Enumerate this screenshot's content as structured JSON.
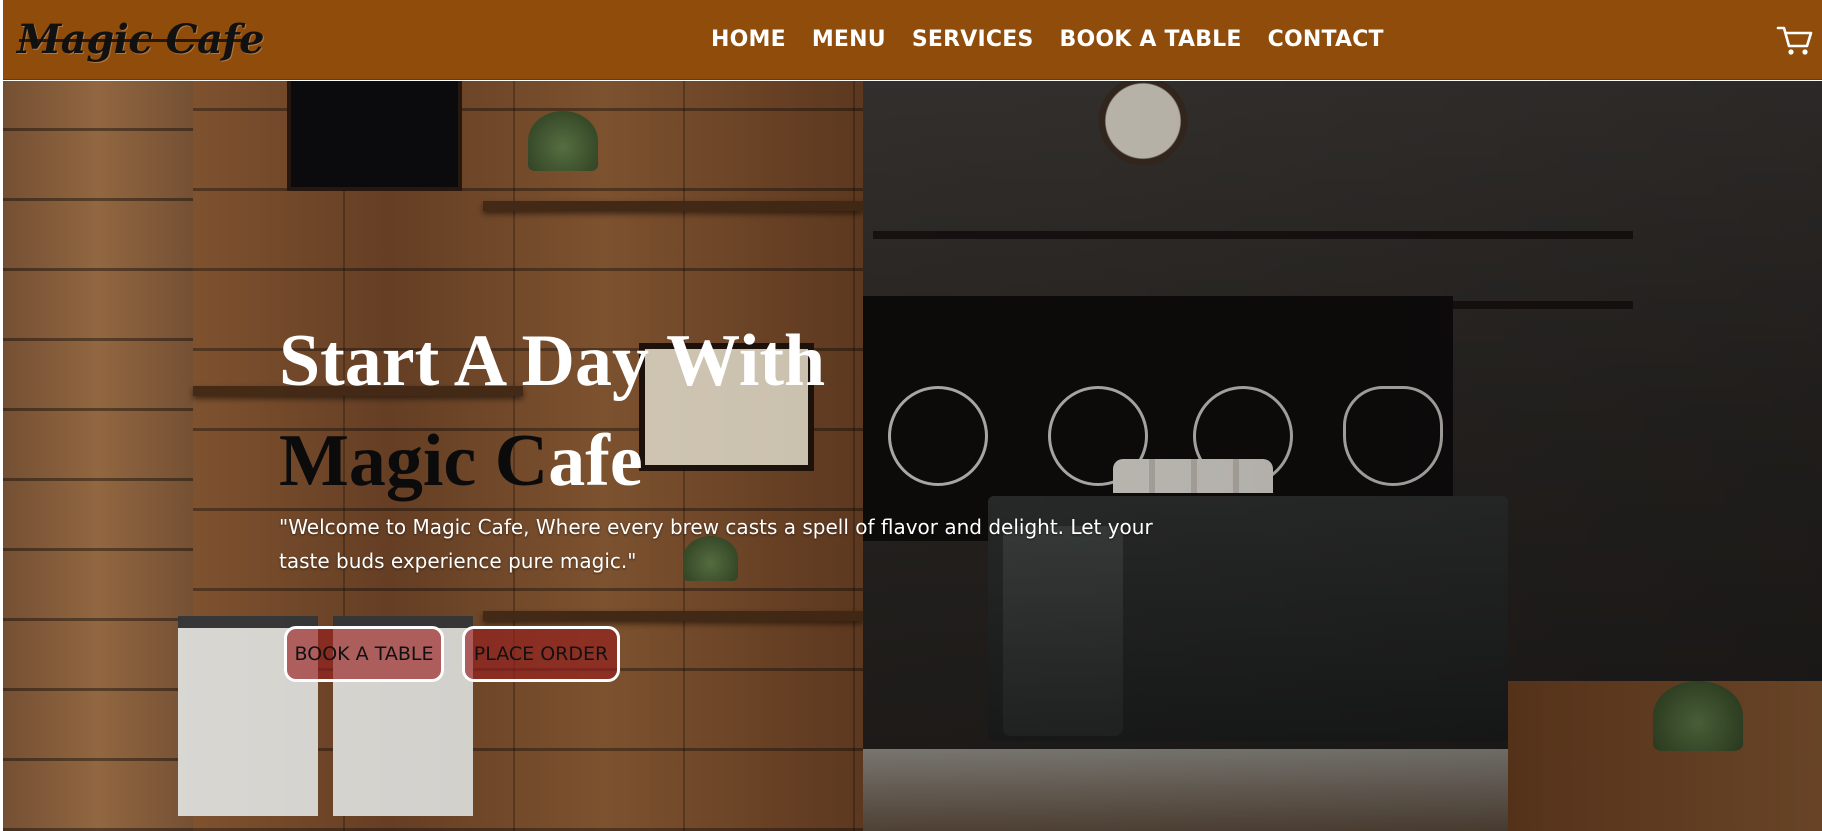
{
  "brand": {
    "name": "Magic Cafe"
  },
  "nav": {
    "items": [
      {
        "label": "HOME"
      },
      {
        "label": "MENU"
      },
      {
        "label": "SERVICES"
      },
      {
        "label": "BOOK A TABLE"
      },
      {
        "label": "CONTACT"
      }
    ],
    "cart_icon": "shopping-cart-icon"
  },
  "hero": {
    "title_line1": "Start A Day With",
    "title_line2_part1": "Magic C",
    "title_line2_part2": "afe",
    "description": "\"Welcome to Magic Cafe, Where every brew casts a spell of flavor and delight. Let your taste buds experience pure magic.\"",
    "buttons": {
      "book": "BOOK A TABLE",
      "order": "PLACE ORDER"
    }
  },
  "colors": {
    "navbar": "#8f4c0a",
    "button_bg": "#961e1e",
    "nav_text": "#ffffff"
  }
}
